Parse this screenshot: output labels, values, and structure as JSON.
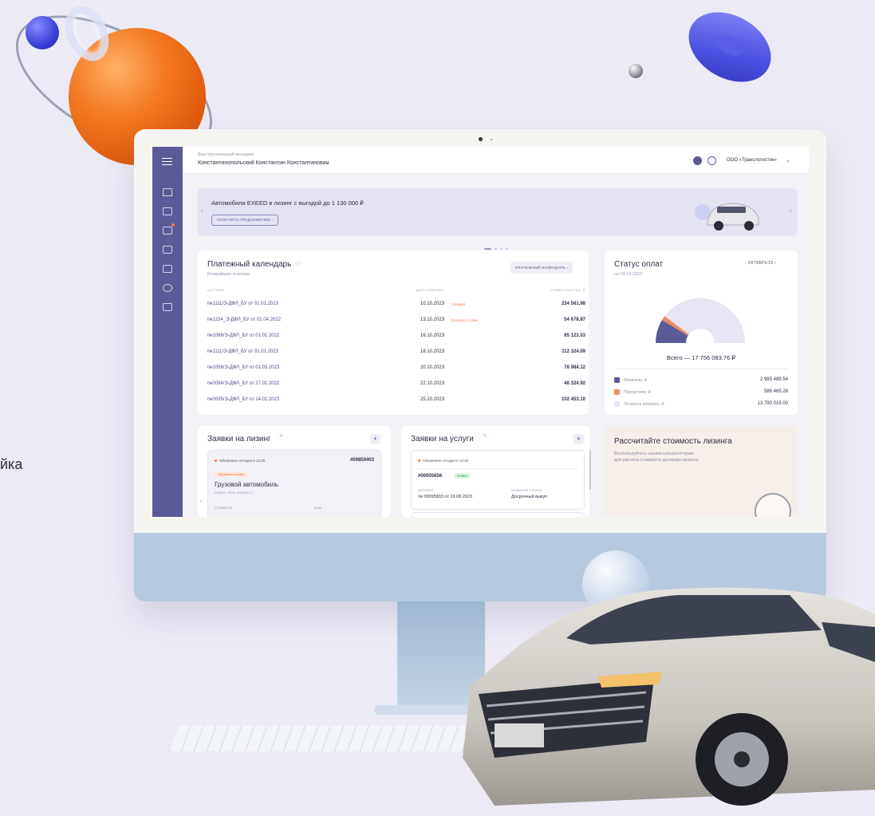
{
  "side_text": "йка",
  "topbar": {
    "manager_caption": "Ваш персональный менеджер",
    "manager_name": "Константинопольский Константин Константинович",
    "company": "ООО «Транслогистик»"
  },
  "banner": {
    "title": "Автомобили EXEED в лизинг с выгодой до 1 130 000 ₽",
    "button": "ПОЛУЧИТЬ ПРЕДЛОЖЕНИЕ"
  },
  "payment_calendar": {
    "title": "Платежный календарь",
    "subtitle": "Ближайшие платежи",
    "button": "ПЛАТЕЖНЫЙ КАЛЕНДАРЬ",
    "columns": {
      "contract": "ДОГОВОР",
      "date": "ДАТА ПЛАТЕЖА",
      "sum": "СУММА ПЛАТЕЖА, ₽"
    },
    "rows": [
      {
        "contract": "№1111/Э-ДФЛ_БУ от 01.01.2023",
        "date": "10.10.2023",
        "note": "Сегодня",
        "sum": "234 561.98"
      },
      {
        "contract": "№1234_Э-ДФЛ_БУ от 01.04.2022",
        "date": "13.10.2023",
        "note": "Осталось 3 дня",
        "sum": "54 678.87"
      },
      {
        "contract": "№1086/Э-ДФЛ_БУ от 01.01.2022",
        "date": "16.10.2023",
        "note": "",
        "sum": "65 123.03"
      },
      {
        "contract": "№1111/Э-ДФЛ_БУ от 01.01.2023",
        "date": "18.10.2023",
        "note": "",
        "sum": "112 324.09"
      },
      {
        "contract": "№1056/Э-ДФЛ_БУ от 01.03.2023",
        "date": "20.10.2023",
        "note": "",
        "sum": "78 984.12"
      },
      {
        "contract": "№0084/Э-ДФЛ_БУ от 27.02.2022",
        "date": "22.10.2023",
        "note": "",
        "sum": "46 324.92"
      },
      {
        "contract": "№0035/Э-ДФЛ_БУ от 14.02.2023",
        "date": "25.10.2023",
        "note": "",
        "sum": "102 453.10"
      }
    ]
  },
  "payment_status": {
    "title": "Статус оплат",
    "as_of": "на 03.10.2023",
    "period": "ОКТЯБРЬ'23",
    "total": "Всего — 17 756 083.76 ₽",
    "legend": [
      {
        "label": "Оплачено, ₽",
        "value": "2 985 489.54",
        "color": "#5b5a98"
      },
      {
        "label": "Просрочено, ₽",
        "value": "586 465.26",
        "color": "#ee8a5c"
      },
      {
        "label": "Осталось оплатить, ₽",
        "value": "13 790 015.00",
        "color": "#e6e5f3"
      }
    ]
  },
  "leasing_requests": {
    "title": "Заявки на лизинг",
    "count": "4",
    "updated": "Обновлено сегодня в 12:30",
    "number": "#09859403",
    "status": "Обработка заявки",
    "name": "Грузовой автомобиль",
    "model": "КАМАЗ, 43081 КОМПАС-9",
    "cost_label": "Стоимость",
    "term_label": "Срок"
  },
  "service_requests": {
    "title": "Заявки на услуги",
    "count": "5",
    "updated": "Обновлено сегодня в 12:30",
    "number": "#00005656",
    "status": "Новая",
    "contract_label": "ДОГОВОР",
    "contract": "№ 00095833 от 19.08.2023",
    "service_label": "НАЗВАНИЕ УСЛУГИ",
    "service": "Досрочный выкуп"
  },
  "calculator": {
    "title": "Рассчитайте стоимость лизинга",
    "text_line1": "Воспользуйтесь нашим калькулятором",
    "text_line2": "для расчета стоимости договора лизинга"
  }
}
